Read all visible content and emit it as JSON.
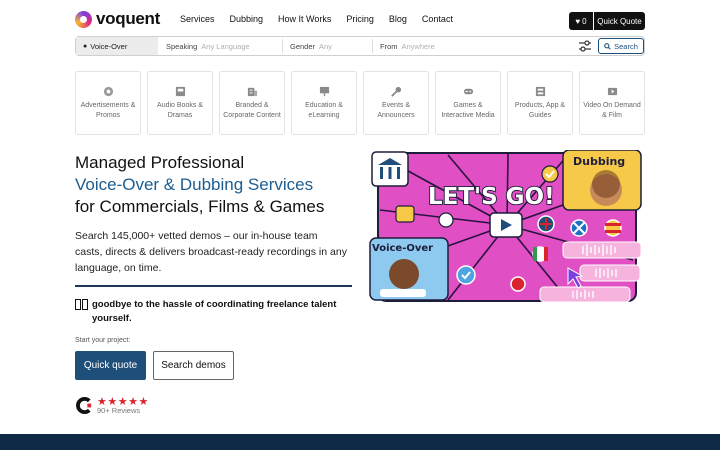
{
  "brand": {
    "name": "voquent"
  },
  "nav": {
    "links": [
      "Services",
      "Dubbing",
      "How It Works",
      "Pricing",
      "Blog",
      "Contact"
    ],
    "favorites_count": "0",
    "quick_quote": "Quick Quote"
  },
  "search": {
    "voice_type": "Voice-Over",
    "speaking_label": "Speaking",
    "speaking_placeholder": "Any Language",
    "gender_label": "Gender",
    "gender_placeholder": "Any",
    "from_label": "From",
    "from_placeholder": "Anywhere",
    "search_button": "Search"
  },
  "categories": [
    {
      "label": "Advertisements & Promos",
      "icon": "megaphone-icon"
    },
    {
      "label": "Audio Books & Dramas",
      "icon": "book-icon"
    },
    {
      "label": "Branded & Corporate Content",
      "icon": "building-icon"
    },
    {
      "label": "Education & eLearning",
      "icon": "presentation-icon"
    },
    {
      "label": "Events & Announcers",
      "icon": "microphone-icon"
    },
    {
      "label": "Games & Interactive Media",
      "icon": "gamepad-icon"
    },
    {
      "label": "Products, App & Guides",
      "icon": "box-icon"
    },
    {
      "label": "Video On Demand & Film",
      "icon": "video-icon"
    }
  ],
  "hero": {
    "line1": "Managed Professional",
    "line2": "Voice-Over & Dubbing Services",
    "line3": "for Commercials, Films & Games",
    "description": "Search 145,000+ vetted demos – our in-house team casts, directs & delivers broadcast-ready recordings in any language, on time.",
    "hassle": "goodbye to the hassle of coordinating freelance talent yourself.",
    "start_label": "Start your project:",
    "quick_quote_button": "Quick quote",
    "search_demos_button": "Search demos",
    "stars": "★★★★★",
    "reviews": "90+ Reviews"
  },
  "illustration": {
    "headline": "LET'S GO!",
    "tag_dubbing": "Dubbing",
    "tag_voiceover": "Voice-Over"
  },
  "colors": {
    "accent": "#1e4e7a",
    "hero_blue": "#1d5d8f",
    "illustration_bg": "#e04fc4",
    "stars": "#d9232d",
    "footer": "#0e2a47"
  }
}
